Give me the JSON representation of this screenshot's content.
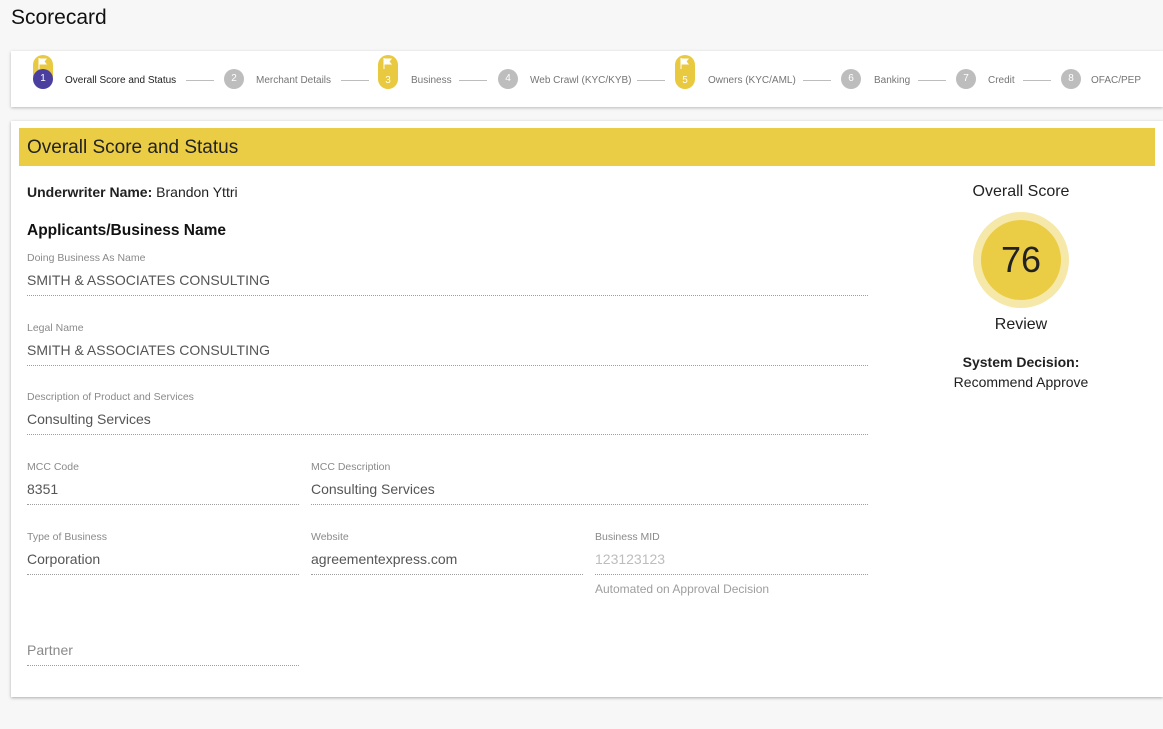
{
  "page": {
    "title": "Scorecard"
  },
  "stepper": {
    "steps": [
      {
        "number": "1",
        "label": "Overall Score and Status",
        "flagged": true,
        "active": true
      },
      {
        "number": "2",
        "label": "Merchant Details",
        "flagged": false,
        "active": false
      },
      {
        "number": "3",
        "label": "Business",
        "flagged": true,
        "active": false
      },
      {
        "number": "4",
        "label": "Web Crawl (KYC/KYB)",
        "flagged": false,
        "active": false
      },
      {
        "number": "5",
        "label": "Owners (KYC/AML)",
        "flagged": true,
        "active": false
      },
      {
        "number": "6",
        "label": "Banking",
        "flagged": false,
        "active": false
      },
      {
        "number": "7",
        "label": "Credit",
        "flagged": false,
        "active": false
      },
      {
        "number": "8",
        "label": "OFAC/PEP",
        "flagged": false,
        "active": false
      }
    ]
  },
  "section": {
    "title": "Overall Score and Status",
    "underwriter_label": "Underwriter Name:",
    "underwriter_name": "Brandon Yttri",
    "subheading": "Applicants/Business Name"
  },
  "fields": {
    "dba": {
      "label": "Doing Business As Name",
      "value": "SMITH & ASSOCIATES CONSULTING"
    },
    "legal": {
      "label": "Legal Name",
      "value": "SMITH & ASSOCIATES CONSULTING"
    },
    "description": {
      "label": "Description of Product and Services",
      "value": "Consulting Services"
    },
    "mcc_code": {
      "label": "MCC Code",
      "value": "8351"
    },
    "mcc_desc": {
      "label": "MCC Description",
      "value": "Consulting Services"
    },
    "type": {
      "label": "Type of Business",
      "value": "Corporation"
    },
    "website": {
      "label": "Website",
      "value": "agreementexpress.com"
    },
    "mid": {
      "label": "Business MID",
      "value": "123123123",
      "hint": "Automated on Approval Decision"
    },
    "partner": {
      "placeholder": "Partner"
    }
  },
  "score": {
    "label": "Overall Score",
    "value": "76",
    "status": "Review",
    "decision_label": "System Decision:",
    "decision_value": "Recommend Approve"
  },
  "colors": {
    "accent": "#ebcd45",
    "active_step": "#4a3f9f"
  },
  "icons": {
    "flag": "flag-icon"
  }
}
